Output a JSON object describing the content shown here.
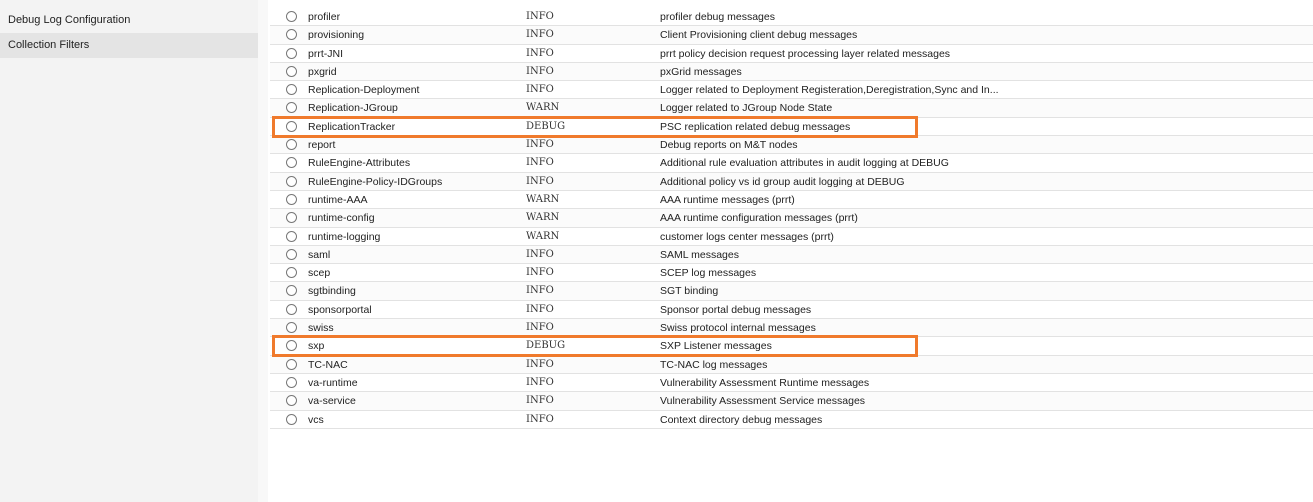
{
  "sidebar": {
    "items": [
      {
        "label": "Debug Log Configuration"
      },
      {
        "label": "Collection Filters"
      }
    ]
  },
  "colors": {
    "highlight": "#f07a2c",
    "sidebar_bg": "#f3f3f3"
  },
  "components": [
    {
      "name": "profiler",
      "level": "INFO",
      "description": "profiler debug messages",
      "highlighted": false
    },
    {
      "name": "provisioning",
      "level": "INFO",
      "description": "Client Provisioning client debug messages",
      "highlighted": false
    },
    {
      "name": "prrt-JNI",
      "level": "INFO",
      "description": "prrt policy decision request processing layer related messages",
      "highlighted": false
    },
    {
      "name": "pxgrid",
      "level": "INFO",
      "description": "pxGrid messages",
      "highlighted": false
    },
    {
      "name": "Replication-Deployment",
      "level": "INFO",
      "description": "Logger related to Deployment Registeration,Deregistration,Sync and In...",
      "highlighted": false
    },
    {
      "name": "Replication-JGroup",
      "level": "WARN",
      "description": "Logger related to JGroup Node State",
      "highlighted": false
    },
    {
      "name": "ReplicationTracker",
      "level": "DEBUG",
      "description": "PSC replication related debug messages",
      "highlighted": true
    },
    {
      "name": "report",
      "level": "INFO",
      "description": "Debug reports on M&T nodes",
      "highlighted": false
    },
    {
      "name": "RuleEngine-Attributes",
      "level": "INFO",
      "description": "Additional rule evaluation attributes in audit logging at DEBUG",
      "highlighted": false
    },
    {
      "name": "RuleEngine-Policy-IDGroups",
      "level": "INFO",
      "description": "Additional policy vs id group audit logging at DEBUG",
      "highlighted": false
    },
    {
      "name": "runtime-AAA",
      "level": "WARN",
      "description": "AAA runtime messages (prrt)",
      "highlighted": false
    },
    {
      "name": "runtime-config",
      "level": "WARN",
      "description": "AAA runtime configuration messages (prrt)",
      "highlighted": false
    },
    {
      "name": "runtime-logging",
      "level": "WARN",
      "description": "customer logs center messages (prrt)",
      "highlighted": false
    },
    {
      "name": "saml",
      "level": "INFO",
      "description": "SAML messages",
      "highlighted": false
    },
    {
      "name": "scep",
      "level": "INFO",
      "description": "SCEP log messages",
      "highlighted": false
    },
    {
      "name": "sgtbinding",
      "level": "INFO",
      "description": "SGT binding",
      "highlighted": false
    },
    {
      "name": "sponsorportal",
      "level": "INFO",
      "description": "Sponsor portal debug messages",
      "highlighted": false
    },
    {
      "name": "swiss",
      "level": "INFO",
      "description": "Swiss protocol internal messages",
      "highlighted": false
    },
    {
      "name": "sxp",
      "level": "DEBUG",
      "description": "SXP Listener messages",
      "highlighted": true
    },
    {
      "name": "TC-NAC",
      "level": "INFO",
      "description": "TC-NAC log messages",
      "highlighted": false
    },
    {
      "name": "va-runtime",
      "level": "INFO",
      "description": "Vulnerability Assessment Runtime messages",
      "highlighted": false
    },
    {
      "name": "va-service",
      "level": "INFO",
      "description": "Vulnerability Assessment Service messages",
      "highlighted": false
    },
    {
      "name": "vcs",
      "level": "INFO",
      "description": "Context directory debug messages",
      "highlighted": false
    }
  ]
}
